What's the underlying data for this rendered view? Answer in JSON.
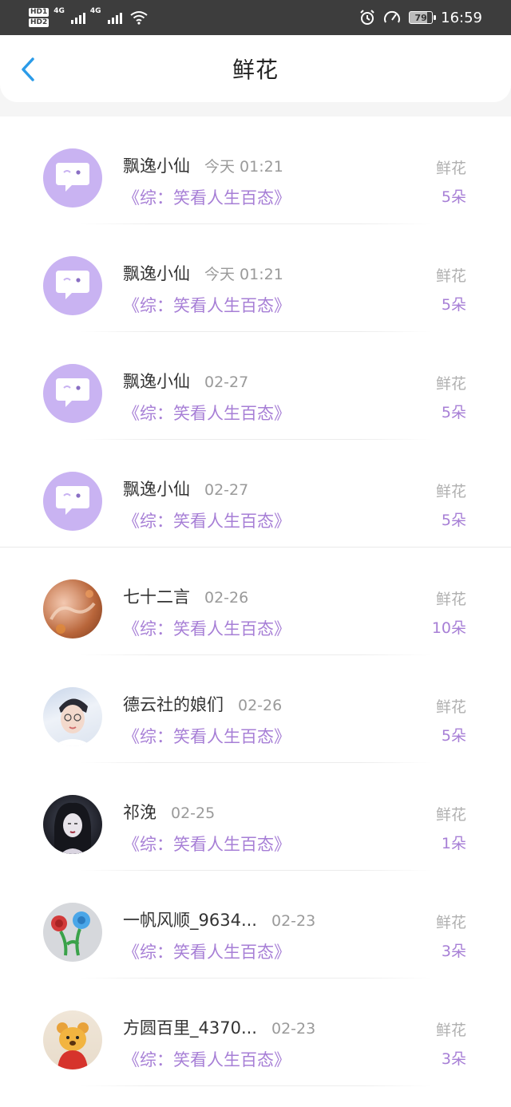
{
  "status_bar": {
    "hd1": "HD1",
    "hd2": "HD2",
    "net1": "4G",
    "net2": "4G",
    "battery": "79",
    "time": "16:59"
  },
  "header": {
    "title": "鲜花",
    "back_icon": "chevron-left-icon",
    "accent": "#2b9be8"
  },
  "colors": {
    "purple": "#a77fd6",
    "avatar_default": "#c9b3f2"
  },
  "records": [
    {
      "user": "飘逸小仙",
      "time": "今天 01:21",
      "book": "《综：笑看人生百态》",
      "label": "鲜花",
      "count": "5朵",
      "avatar": "default"
    },
    {
      "user": "飘逸小仙",
      "time": "今天 01:21",
      "book": "《综：笑看人生百态》",
      "label": "鲜花",
      "count": "5朵",
      "avatar": "default"
    },
    {
      "user": "飘逸小仙",
      "time": "02-27",
      "book": "《综：笑看人生百态》",
      "label": "鲜花",
      "count": "5朵",
      "avatar": "default"
    },
    {
      "user": "飘逸小仙",
      "time": "02-27",
      "book": "《综：笑看人生百态》",
      "label": "鲜花",
      "count": "5朵",
      "avatar": "default"
    },
    {
      "user": "七十二言",
      "time": "02-26",
      "book": "《综：笑看人生百态》",
      "label": "鲜花",
      "count": "10朵",
      "avatar": "photo-autumn"
    },
    {
      "user": "德云社的娘们",
      "time": "02-26",
      "book": "《综：笑看人生百态》",
      "label": "鲜花",
      "count": "5朵",
      "avatar": "photo-man"
    },
    {
      "user": "祁浼",
      "time": "02-25",
      "book": "《综：笑看人生百态》",
      "label": "鲜花",
      "count": "1朵",
      "avatar": "photo-woman"
    },
    {
      "user": "一帆风顺_9634...",
      "time": "02-23",
      "book": "《综：笑看人生百态》",
      "label": "鲜花",
      "count": "3朵",
      "avatar": "photo-flowers"
    },
    {
      "user": "方圆百里_4370...",
      "time": "02-23",
      "book": "《综：笑看人生百态》",
      "label": "鲜花",
      "count": "3朵",
      "avatar": "photo-bear"
    }
  ]
}
